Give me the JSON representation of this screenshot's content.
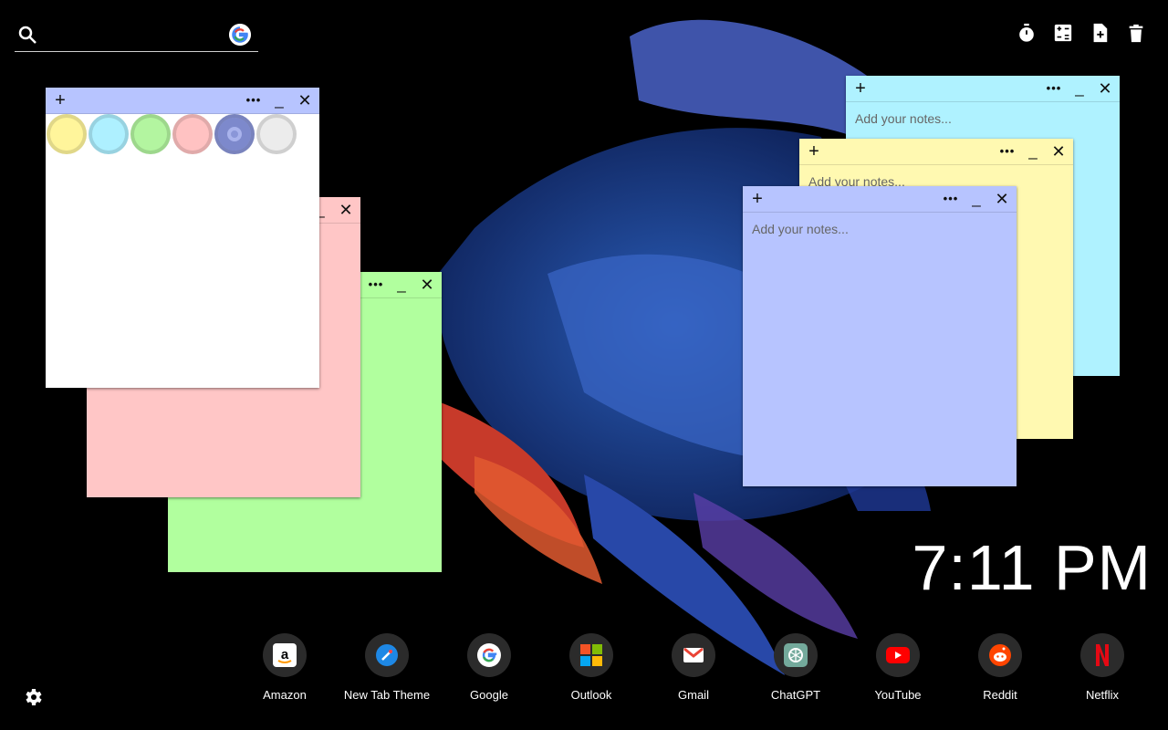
{
  "search": {
    "placeholder": ""
  },
  "toolbar": {
    "icons": [
      "timer-icon",
      "calculator-icon",
      "new-note-icon",
      "trash-icon"
    ]
  },
  "notes": {
    "placeholder": "Add your notes...",
    "colors": {
      "yellow": "#fff9b1",
      "blue": "#aff2ff",
      "green": "#b1ff9e",
      "pink": "#ffc6c6",
      "purple": "#b7c4ff",
      "white": "#ffffff"
    }
  },
  "palette": [
    "#fff59b",
    "#aef0ff",
    "#b3f5a0",
    "#ffc2c2",
    "#8a96d8",
    "#ececec"
  ],
  "clock": {
    "time": "7:11 PM"
  },
  "shortcuts": [
    {
      "label": "Amazon",
      "icon": "amazon-icon"
    },
    {
      "label": "New Tab Theme",
      "icon": "new-tab-theme-icon"
    },
    {
      "label": "Google",
      "icon": "google-icon"
    },
    {
      "label": "Outlook",
      "icon": "outlook-icon"
    },
    {
      "label": "Gmail",
      "icon": "gmail-icon"
    },
    {
      "label": "ChatGPT",
      "icon": "chatgpt-icon"
    },
    {
      "label": "YouTube",
      "icon": "youtube-icon"
    },
    {
      "label": "Reddit",
      "icon": "reddit-icon"
    },
    {
      "label": "Netflix",
      "icon": "netflix-icon"
    }
  ]
}
